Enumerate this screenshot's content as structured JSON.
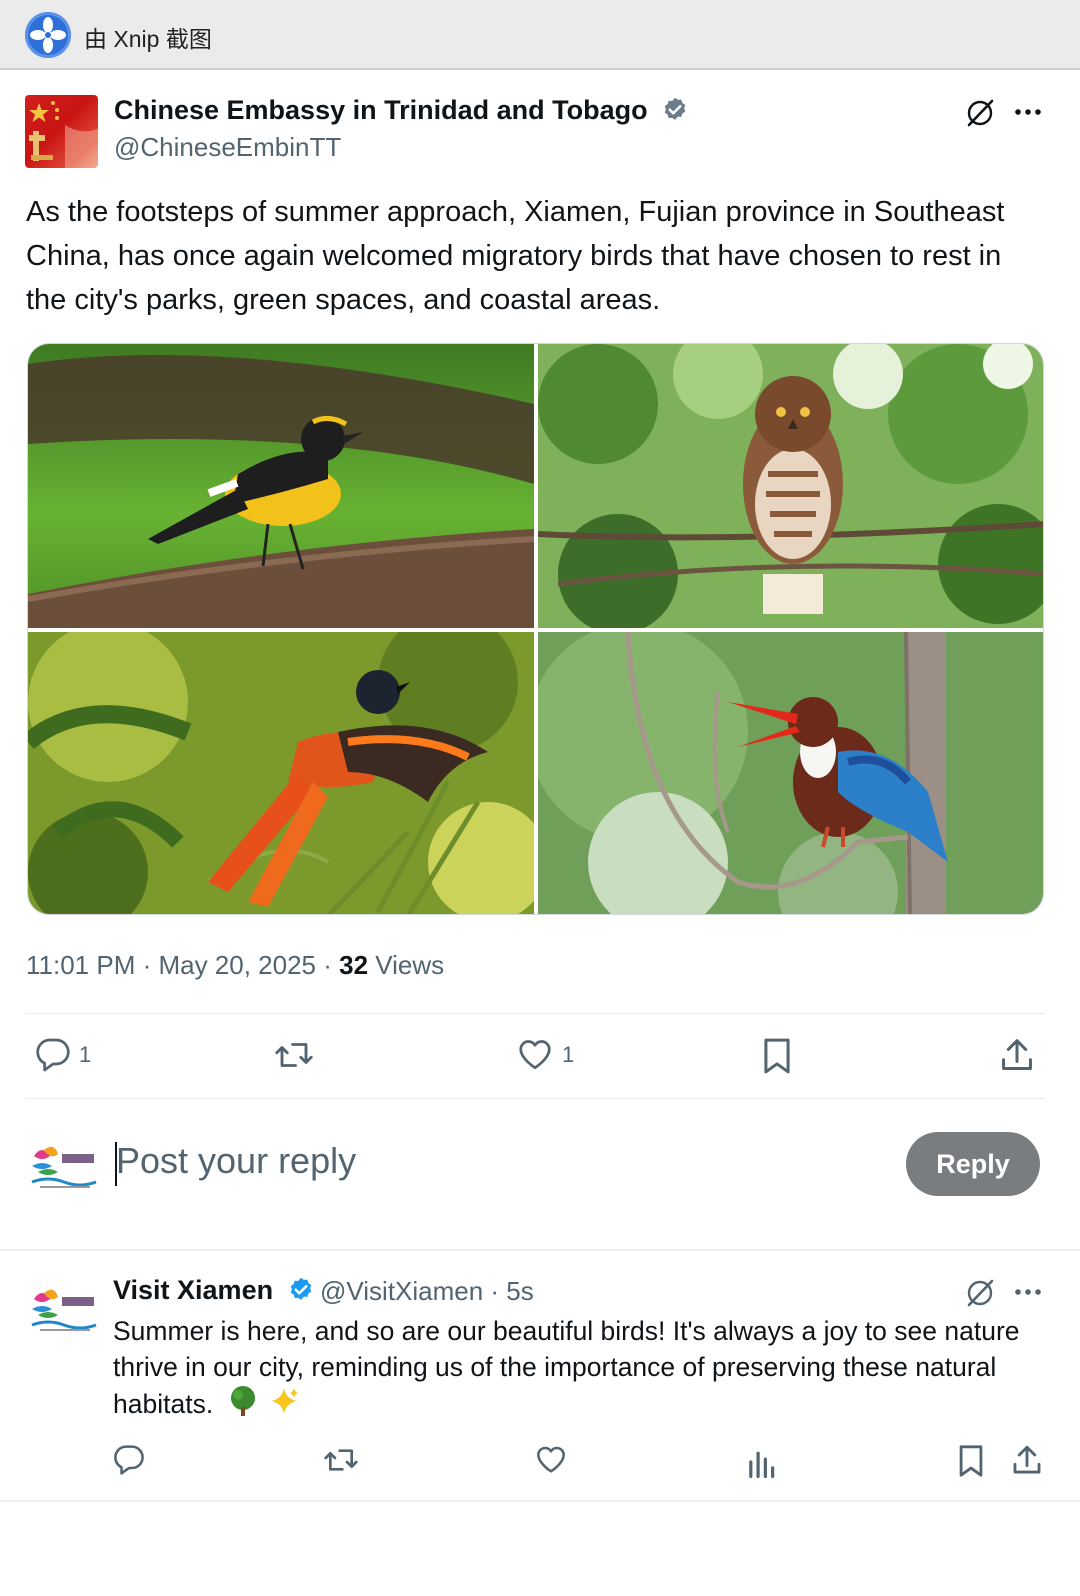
{
  "capture_bar": {
    "label": "由 Xnip 截图",
    "icon": "xnip-logo-icon"
  },
  "tweet": {
    "author_name": "Chinese Embassy in Trinidad and Tobago",
    "author_handle": "@ChineseEmbinTT",
    "text": "As the footsteps of summer approach, Xiamen, Fujian province in Southeast China, has once again welcomed migratory birds that have chosen to rest in the city's parks, green spaces, and coastal areas.",
    "media": [
      {
        "icon": "yellow-black-flycatcher-photo"
      },
      {
        "icon": "brown-owl-photo"
      },
      {
        "icon": "orange-minivet-photo"
      },
      {
        "icon": "kingfisher-photo"
      }
    ],
    "time": "11:01 PM · May 20, 2025 · ",
    "views_count": "32",
    "views_label": " Views",
    "actions": {
      "reply_count": "1",
      "like_count": "1"
    }
  },
  "composer": {
    "placeholder": "Post your reply",
    "reply_button": "Reply"
  },
  "reply": {
    "author_name": "Visit Xiamen",
    "author_handle": "@VisitXiamen · 5s",
    "text": "Summer is here, and so are our beautiful birds! It's always a joy to see nature thrive in our city, reminding us of the importance of preserving these natural habitats.",
    "emoji": [
      "tree-emoji",
      "sparkles-emoji"
    ]
  },
  "colors": {
    "text_primary": "#0f1419",
    "text_secondary": "#536471",
    "verified_blue": "#1d9bf0",
    "reply_button_bg": "#7a7d80",
    "divider": "#e6ecf0"
  }
}
